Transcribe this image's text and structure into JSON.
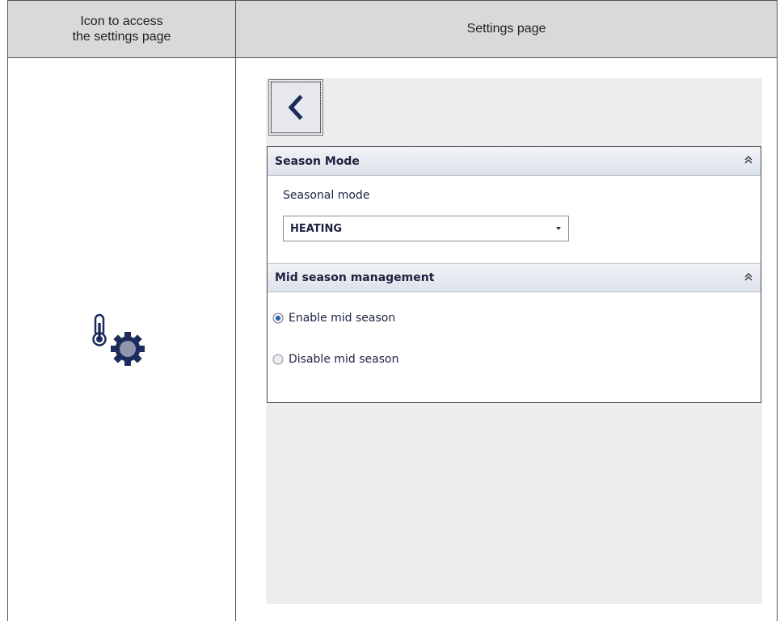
{
  "table": {
    "col1_header_line1": "Icon to access",
    "col1_header_line2": "the settings page",
    "col2_header": "Settings page"
  },
  "icons": {
    "left": "thermometer-gear-icon",
    "back": "chevron-left-icon",
    "collapse": "double-chevron-up-icon"
  },
  "settings": {
    "season_mode": {
      "title": "Season Mode",
      "field_label": "Seasonal mode",
      "selected_value": "HEATING"
    },
    "mid_season": {
      "title": "Mid season management",
      "options": [
        {
          "label": "Enable mid season",
          "selected": true
        },
        {
          "label": "Disable mid season",
          "selected": false
        }
      ]
    }
  },
  "colors": {
    "header_bg": "#d9d9d9",
    "panel_bg": "#ededed",
    "icon_blue": "#1d2b5c",
    "text_navy": "#1c2240"
  }
}
